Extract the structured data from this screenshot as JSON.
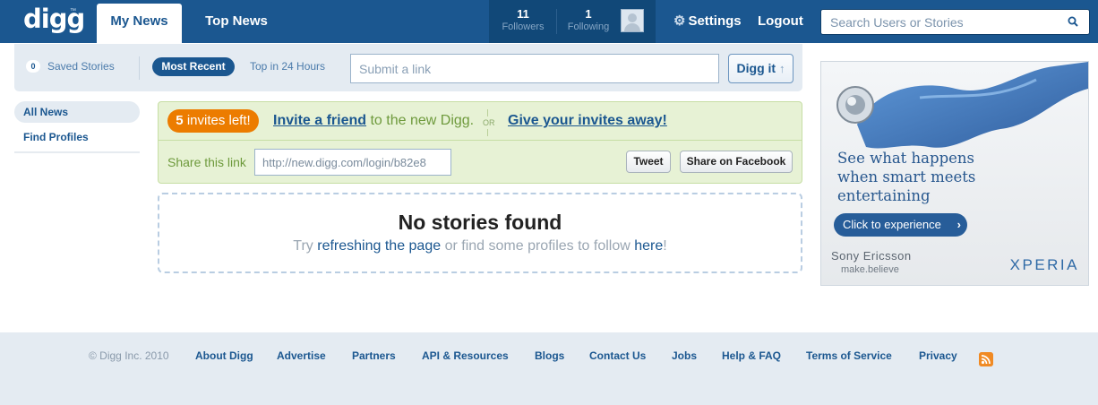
{
  "header": {
    "logo": "digg",
    "logo_tm": "™",
    "tabs": [
      {
        "label": "My News",
        "active": true
      },
      {
        "label": "Top News",
        "active": false
      }
    ],
    "followers": {
      "count": "11",
      "label": "Followers"
    },
    "following": {
      "count": "1",
      "label": "Following"
    },
    "settings_label": "Settings",
    "logout_label": "Logout",
    "search_placeholder": "Search Users or Stories"
  },
  "toolbar": {
    "saved_count": "0",
    "saved_label": "Saved Stories",
    "most_recent_label": "Most Recent",
    "top24_label": "Top in 24 Hours",
    "submit_placeholder": "Submit a link",
    "diggit_label": "Digg it"
  },
  "sidebar": {
    "items": [
      {
        "label": "All News",
        "active": true
      },
      {
        "label": "Find Profiles",
        "active": false
      }
    ]
  },
  "invite": {
    "count": "5",
    "badge_suffix": "invites left!",
    "invite_link": "Invite a friend",
    "invite_tail": "to the new Digg.",
    "or_label": "OR",
    "give_link": "Give your invites away!",
    "share_label": "Share this link",
    "share_value": "http://new.digg.com/login/b82e8",
    "tweet_label": "Tweet",
    "facebook_label": "Share on Facebook"
  },
  "empty": {
    "title": "No stories found",
    "try": "Try",
    "refresh_link": "refreshing the page",
    "middle": "or find some profiles to follow",
    "here_link": "here",
    "end": "!"
  },
  "ad": {
    "headline": "See what happens\nwhen smart meets\nentertaining",
    "cta": "Click to experience",
    "brand": "Sony Ericsson",
    "tagline": "make.believe",
    "product": "XPERIA"
  },
  "footer": {
    "copyright": "© Digg Inc. 2010",
    "links": [
      "About Digg",
      "Advertise",
      "Partners",
      "API & Resources",
      "Blogs",
      "Contact Us",
      "Jobs",
      "Help & FAQ",
      "Terms of Service",
      "Privacy"
    ]
  },
  "colors": {
    "header_bg": "#1b5790",
    "accent_orange": "#ec7c00",
    "invite_bg": "#e7f2d5",
    "footer_bg": "#e4ebf2"
  },
  "icons": [
    "gear-icon",
    "search-icon",
    "up-arrow-icon",
    "rss-icon",
    "chevron-right-icon"
  ]
}
